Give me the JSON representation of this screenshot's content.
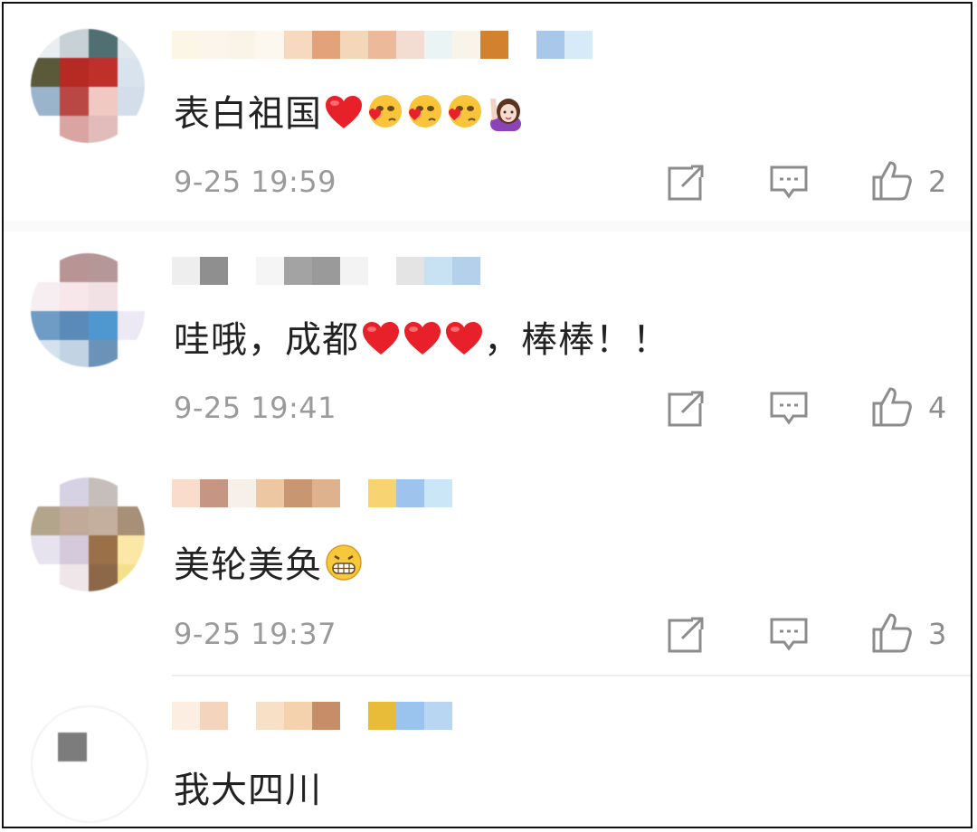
{
  "comments": [
    {
      "text": "表白祖国",
      "time": "9-25 19:59",
      "likes": "2",
      "emojis": [
        "red-heart",
        "blush-heart-face",
        "blush-heart-face",
        "blush-heart-face",
        "raising-hand-woman"
      ]
    },
    {
      "text": "哇哦，成都",
      "text_after": "，棒棒！！",
      "time": "9-25 19:41",
      "likes": "4",
      "emojis": [
        "red-heart",
        "red-heart",
        "red-heart"
      ]
    },
    {
      "text": "美轮美奂",
      "time": "9-25 19:37",
      "likes": "3",
      "emojis": [
        "grinning-face"
      ]
    },
    {
      "text": "我大四川"
    }
  ],
  "icons": {
    "repost": "repost-icon",
    "comment": "comment-icon",
    "like": "thumbs-up-icon"
  },
  "colors": {
    "text": "#222222",
    "meta": "#9a9a9a",
    "icon": "#8c8c8c",
    "heart": "#e8202a"
  }
}
